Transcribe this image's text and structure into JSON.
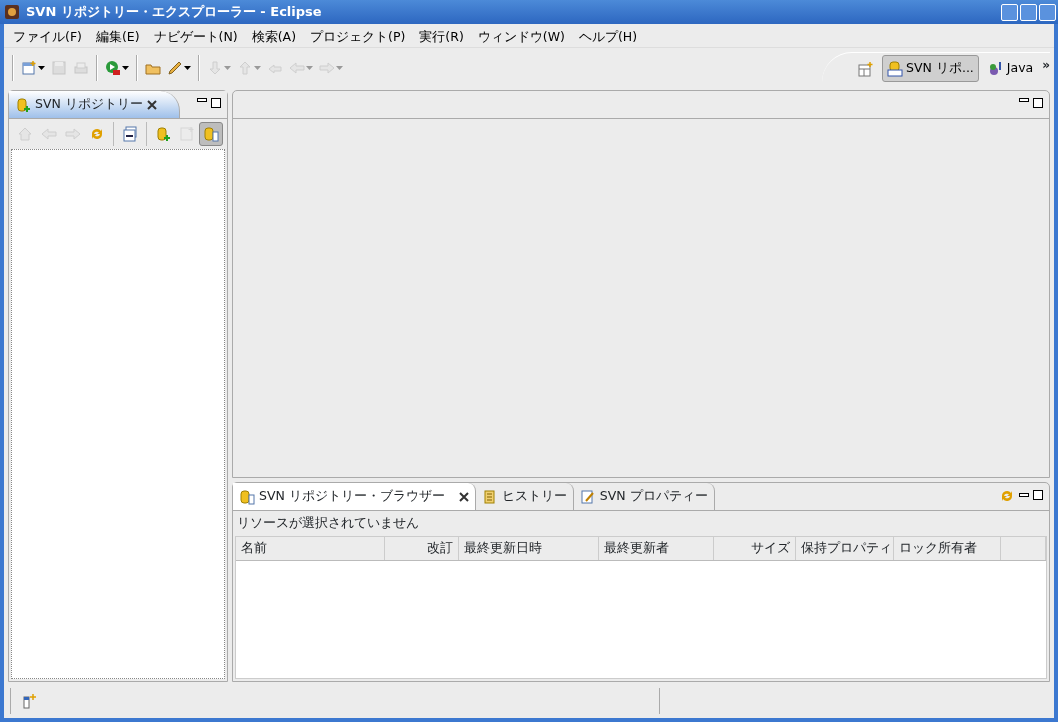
{
  "window": {
    "title": "SVN リポジトリー・エクスプローラー - Eclipse"
  },
  "menu": [
    "ファイル(F)",
    "編集(E)",
    "ナビゲート(N)",
    "検索(A)",
    "プロジェクト(P)",
    "実行(R)",
    "ウィンドウ(W)",
    "ヘルプ(H)"
  ],
  "toolbar": [
    [
      {
        "kind": "new",
        "disabled": false,
        "dropdown": true
      },
      {
        "kind": "save",
        "disabled": true,
        "dropdown": false
      },
      {
        "kind": "print",
        "disabled": true,
        "dropdown": false
      }
    ],
    [
      {
        "kind": "run",
        "disabled": false,
        "dropdown": true
      }
    ],
    [
      {
        "kind": "open",
        "disabled": false,
        "dropdown": false
      },
      {
        "kind": "pen",
        "disabled": false,
        "dropdown": true
      }
    ],
    [
      {
        "kind": "next",
        "disabled": true,
        "dropdown": true
      },
      {
        "kind": "prev",
        "disabled": true,
        "dropdown": true
      },
      {
        "kind": "lastedit",
        "disabled": true,
        "dropdown": false
      },
      {
        "kind": "back",
        "disabled": true,
        "dropdown": true
      },
      {
        "kind": "forward",
        "disabled": true,
        "dropdown": true
      }
    ]
  ],
  "perspectives": [
    {
      "label": "SVN リポ...",
      "kind": "svn",
      "selected": true
    },
    {
      "label": "Java",
      "kind": "java",
      "selected": false
    }
  ],
  "perspective_more": "»",
  "left_view": {
    "tab": "SVN リポジトリー",
    "toolbar": [
      [
        {
          "kind": "home",
          "disabled": true,
          "pressed": false
        },
        {
          "kind": "back",
          "disabled": true,
          "pressed": false
        },
        {
          "kind": "forward",
          "disabled": true,
          "pressed": false
        },
        {
          "kind": "refresh",
          "disabled": false,
          "pressed": false
        }
      ],
      [
        {
          "kind": "collapse",
          "disabled": false,
          "pressed": false
        }
      ],
      [
        {
          "kind": "addrepo",
          "disabled": false,
          "pressed": false
        },
        {
          "kind": "svnfile",
          "disabled": true,
          "pressed": false
        },
        {
          "kind": "browse",
          "disabled": false,
          "pressed": true
        }
      ]
    ]
  },
  "bottom_view": {
    "tabs": [
      {
        "label": "SVN リポジトリー・ブラウザー",
        "kind": "browse",
        "selected": true
      },
      {
        "label": "ヒストリー",
        "kind": "history",
        "selected": false
      },
      {
        "label": "SVN プロパティー",
        "kind": "props",
        "selected": false
      }
    ],
    "message": "リソースが選択されていません",
    "columns": [
      "名前",
      "改訂",
      "最終更新日時",
      "最終更新者",
      "サイズ",
      "保持プロパティ",
      "ロック所有者"
    ]
  }
}
